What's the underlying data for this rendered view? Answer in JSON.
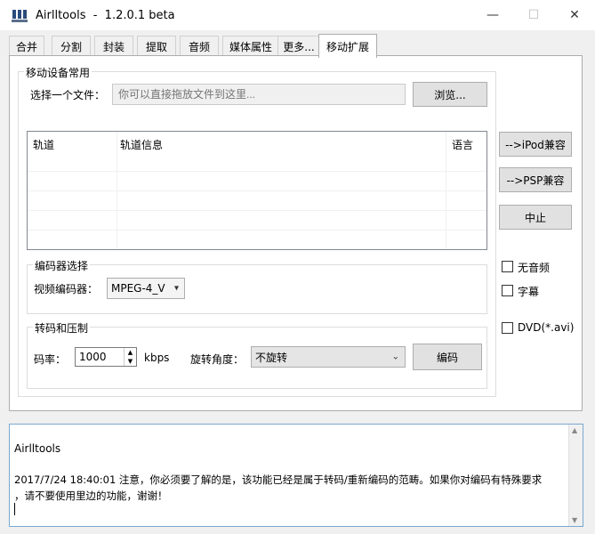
{
  "window": {
    "title": "Airlltools  -  1.2.0.1 beta",
    "controls": {
      "minimize": "—",
      "maximize": "☐",
      "close": "✕"
    }
  },
  "tabs": [
    "合并",
    "分割",
    "封装",
    "提取",
    "音频",
    "媒体属性",
    "更多...",
    "移动扩展"
  ],
  "mobile_group": {
    "title": "移动设备常用",
    "file_label": "选择一个文件：",
    "file_placeholder": "你可以直接拖放文件到这里...",
    "browse_label": "浏览..."
  },
  "track_table": {
    "headers": [
      "轨道",
      "轨道信息",
      "语言"
    ]
  },
  "side_buttons": {
    "ipod": "-->iPod兼容",
    "psp": "-->PSP兼容",
    "abort": "中止"
  },
  "side_checks": {
    "no_audio": "无音频",
    "subtitle": "字幕",
    "dvd": "DVD(*.avi)"
  },
  "encoder_group": {
    "title": "编码器选择",
    "video_encoder_label": "视频编码器：",
    "video_encoder_value": "MPEG-4_V"
  },
  "transcode_group": {
    "title": "转码和压制",
    "bitrate_label": "码率：",
    "bitrate_value": "1000",
    "bitrate_unit": "kbps",
    "rotate_label": "旋转角度：",
    "rotate_value": "不旋转",
    "encode_label": "编码"
  },
  "log": {
    "heading": "Airlltools",
    "message_line1": "2017/7/24 18:40:01  注意，你必须要了解的是，该功能已经是属于转码/重新编码的范畴。如果你对编码有特殊要求",
    "message_line2": "，请不要使用里边的功能，谢谢！"
  }
}
